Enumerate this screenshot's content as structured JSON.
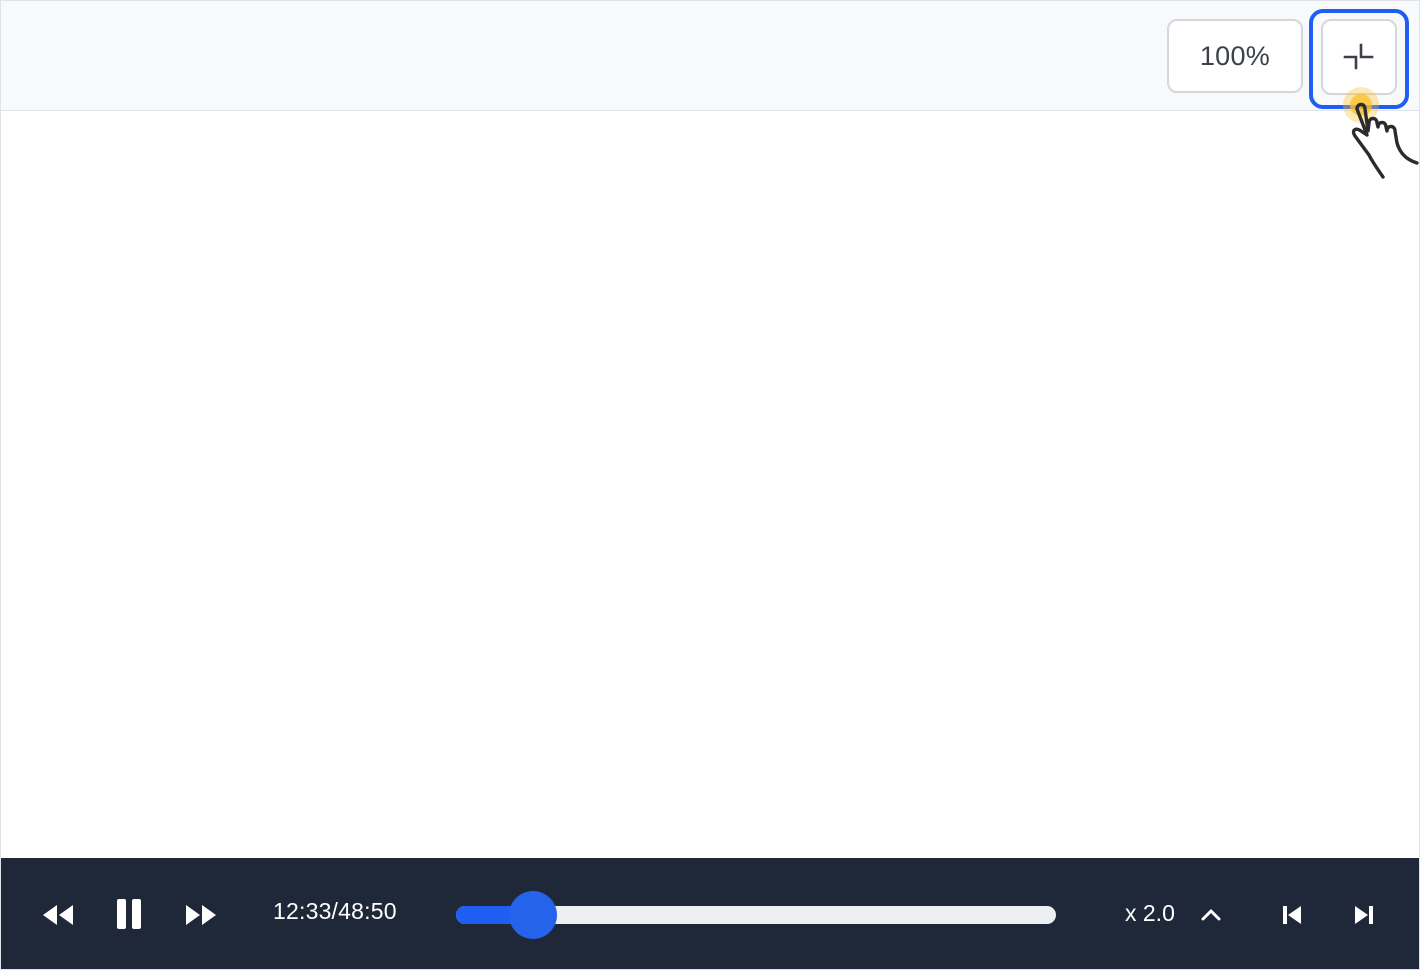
{
  "toolbar": {
    "zoom_label": "100%",
    "exit_fullscreen_icon": "exit-fullscreen-icon",
    "cursor_icon": "hand-pointer-icon"
  },
  "player": {
    "rewind_icon": "rewind-icon",
    "pause_icon": "pause-icon",
    "forward_icon": "fast-forward-icon",
    "time_display": "12:33/48:50",
    "progress_fraction": 0.128,
    "speed_label": "x 2.0",
    "speed_menu_icon": "chevron-up-icon",
    "prev_icon": "skip-previous-icon",
    "next_icon": "skip-next-icon"
  },
  "colors": {
    "accent": "#1e5ef3",
    "control_bar": "#1f2839",
    "track": "#eeeff2",
    "toolbar_bg": "#f8f9fb",
    "cursor_highlight": "#fbbf24"
  }
}
